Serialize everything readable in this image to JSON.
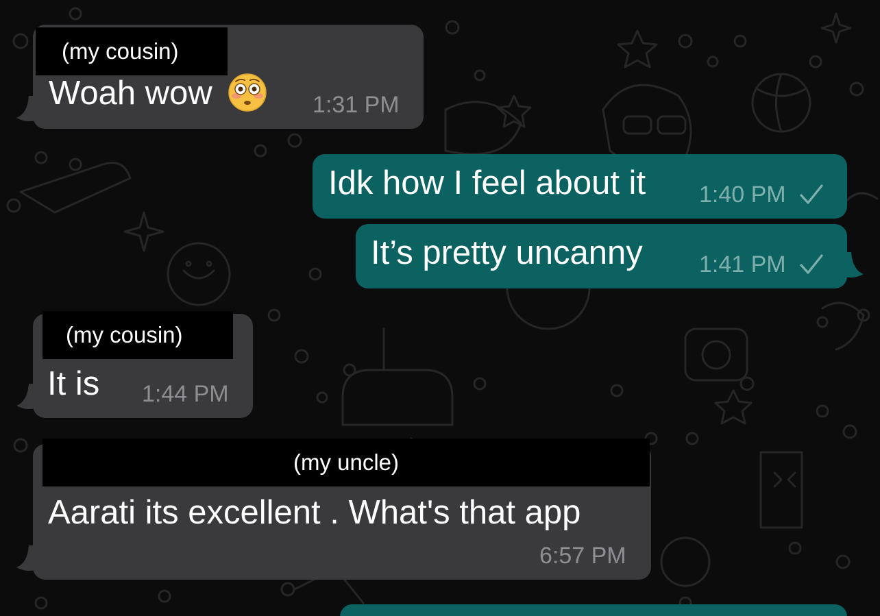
{
  "messages": [
    {
      "sender": "(my cousin)",
      "text": "Woah wow",
      "time": "1:31 PM",
      "emoji": "flushed-face"
    },
    {
      "text": "Idk how I feel about it",
      "time": "1:40 PM",
      "status": "sent"
    },
    {
      "text": "It’s pretty uncanny",
      "time": "1:41 PM",
      "status": "sent"
    },
    {
      "sender": "(my cousin)",
      "text": "It is",
      "time": "1:44 PM"
    },
    {
      "sender": "(my uncle)",
      "text": "Aarati its excellent . What's that app",
      "time": "6:57 PM"
    }
  ],
  "colors": {
    "background": "#0c0c0c",
    "incoming_bubble": "#3a3a3c",
    "outgoing_bubble": "#0b6261",
    "timestamp": "#8e8e93",
    "outgoing_timestamp": "#7fb0ad",
    "sender_label_bg": "#000000"
  }
}
